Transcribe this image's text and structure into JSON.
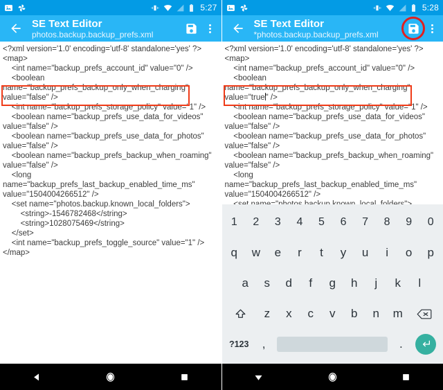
{
  "colors": {
    "status_bar": "#039be5",
    "app_bar": "#29b6f6",
    "highlight_box": "#ef3a17",
    "annotation_circle": "#e02020",
    "keyboard_bg": "#eceff1",
    "space_key": "#cfd8dc",
    "enter_key": "#35b0a0",
    "nav_bar": "#000000",
    "code_text": "#3c3c3c"
  },
  "left": {
    "status_bar": {
      "left_icons": [
        "screenshot-icon",
        "photos-pinwheel-icon"
      ],
      "right_icons": [
        "vibrate-icon",
        "wifi-icon",
        "signal-icon",
        "battery-icon"
      ],
      "clock": "5:27"
    },
    "app_bar": {
      "back_label": "back-arrow-icon",
      "title": "SE Text Editor",
      "subtitle": "photos.backup.backup_prefs.xml",
      "save_label": "save-icon",
      "menu_label": "overflow-menu-icon",
      "save_highlighted": false
    },
    "code": "<?xml version='1.0' encoding='utf-8' standalone='yes' ?>\n<map>\n    <int name=\"backup_prefs_account_id\" value=\"0\" />\n    <boolean\nname=\"backup_prefs_backup_only_when_charging\"\nvalue=\"false\" />\n    <int name=\"backup_prefs_storage_policy\" value=\"1\" />\n    <boolean name=\"backup_prefs_use_data_for_videos\"\nvalue=\"false\" />\n    <boolean name=\"backup_prefs_use_data_for_photos\"\nvalue=\"false\" />\n    <boolean name=\"backup_prefs_backup_when_roaming\"\nvalue=\"false\" />\n    <long name=\"backup_prefs_last_backup_enabled_time_ms\"\nvalue=\"1504004266512\" />\n    <set name=\"photos.backup.known_local_folders\">\n        <string>-1546782468</string>\n        <string>1028075469</string>\n    </set>\n    <int name=\"backup_prefs_toggle_source\" value=\"1\" />\n</map>",
    "highlight": {
      "line1": "name=\"backup_prefs_backup_only_when_charging\"",
      "line2": "value=\"false\" />"
    },
    "nav_bar": {
      "back": "back-triangle-icon",
      "home": "home-circle-icon",
      "recents": "recents-square-icon"
    }
  },
  "right": {
    "status_bar": {
      "left_icons": [
        "screenshot-icon",
        "photos-pinwheel-icon"
      ],
      "right_icons": [
        "vibrate-icon",
        "wifi-icon",
        "signal-icon",
        "battery-icon"
      ],
      "clock": "5:28"
    },
    "app_bar": {
      "back_label": "back-arrow-icon",
      "title": "SE Text Editor",
      "subtitle": "*photos.backup.backup_prefs.xml",
      "save_label": "save-icon",
      "menu_label": "overflow-menu-icon",
      "save_highlighted": true
    },
    "code": "<?xml version='1.0' encoding='utf-8' standalone='yes' ?>\n<map>\n    <int name=\"backup_prefs_account_id\" value=\"0\" />\n    <boolean\nname=\"backup_prefs_backup_only_when_charging\"\nvalue=\"true\" />\n    <int name=\"backup_prefs_storage_policy\" value=\"1\" />\n    <boolean name=\"backup_prefs_use_data_for_videos\"\nvalue=\"false\" />\n    <boolean name=\"backup_prefs_use_data_for_photos\"\nvalue=\"false\" />\n    <boolean name=\"backup_prefs_backup_when_roaming\"\nvalue=\"false\" />\n    <long name=\"backup_prefs_last_backup_enabled_time_ms\"\nvalue=\"1504004266512\" />\n    <set name=\"photos.backup.known_local_folders\">\n        <string>-1546782468</string>\n        <string>1028075469</string>\n    </set>\n    <int name=\"backup_prefs_toggle_source\" value=\"1\" />\n</map>",
    "highlight": {
      "line1": "name=\"backup_prefs_backup_only_when_charging\"",
      "line2": "value=\"true\" />"
    },
    "keyboard": {
      "row_numbers": [
        "1",
        "2",
        "3",
        "4",
        "5",
        "6",
        "7",
        "8",
        "9",
        "0"
      ],
      "row_top": [
        "q",
        "w",
        "e",
        "r",
        "t",
        "y",
        "u",
        "i",
        "o",
        "p"
      ],
      "row_home": [
        "a",
        "s",
        "d",
        "f",
        "g",
        "h",
        "j",
        "k",
        "l"
      ],
      "row_bottom": [
        "z",
        "x",
        "c",
        "v",
        "b",
        "n",
        "m"
      ],
      "shift_label": "shift-icon",
      "backspace_label": "backspace-icon",
      "symbols_label": "?123",
      "comma_label": ",",
      "period_label": ".",
      "space_label": "space-key",
      "enter_label": "enter-icon"
    },
    "nav_bar": {
      "back": "hide-keyboard-triangle-icon",
      "home": "home-circle-icon",
      "recents": "recents-square-icon"
    }
  }
}
